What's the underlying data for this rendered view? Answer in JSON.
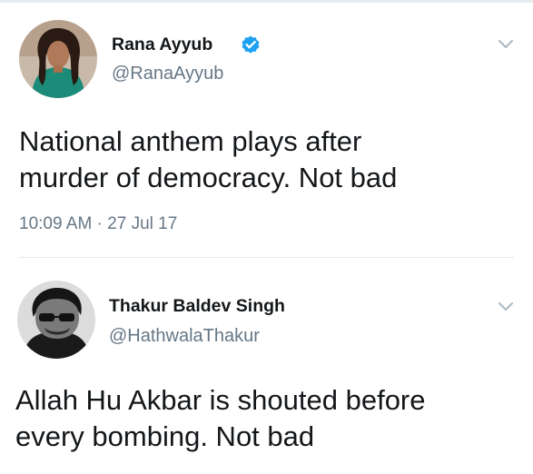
{
  "tweets": [
    {
      "display_name": "Rana Ayyub",
      "handle": "@RanaAyyub",
      "verified": true,
      "text_lines": [
        "National anthem plays after",
        "murder of democracy. Not bad"
      ],
      "timestamp": "10:09 AM · 27 Jul 17",
      "avatar_icon": "avatar-woman-photo",
      "menu_icon": "chevron-down-icon"
    },
    {
      "display_name": "Thakur Baldev Singh",
      "handle": "@HathwalaThakur",
      "verified": false,
      "text_lines": [
        "Allah Hu Akbar is shouted before",
        "every bombing. Not bad"
      ],
      "avatar_icon": "avatar-man-sunglasses-photo",
      "menu_icon": "chevron-down-icon"
    }
  ],
  "colors": {
    "text_primary": "#14171a",
    "text_secondary": "#657786",
    "verified_blue": "#1da1f2",
    "divider": "#e1e8ed"
  }
}
